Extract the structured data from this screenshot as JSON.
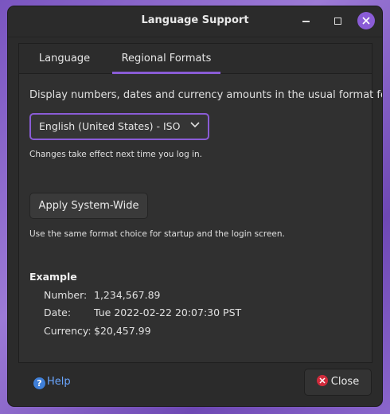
{
  "window": {
    "title": "Language Support"
  },
  "tabs": [
    {
      "label": "Language"
    },
    {
      "label": "Regional Formats"
    }
  ],
  "regional": {
    "description": "Display numbers, dates and currency amounts in the usual format for:",
    "format_selected": "English (United States) - ISO",
    "note_login": "Changes take effect next time you log in.",
    "apply_label": "Apply System-Wide",
    "note_systemwide": "Use the same format choice for startup and the login screen."
  },
  "example": {
    "title": "Example",
    "rows": [
      {
        "label": "Number:",
        "value": "1,234,567.89"
      },
      {
        "label": "Date:",
        "value": "Tue 2022-02-22 20:07:30 PST"
      },
      {
        "label": "Currency:",
        "value": "$20,457.99"
      }
    ]
  },
  "footer": {
    "help_label": "Help",
    "close_label": "Close"
  },
  "colors": {
    "accent": "#8a5cd6",
    "link": "#6aa6ff",
    "close_icon": "#d12b3c"
  }
}
